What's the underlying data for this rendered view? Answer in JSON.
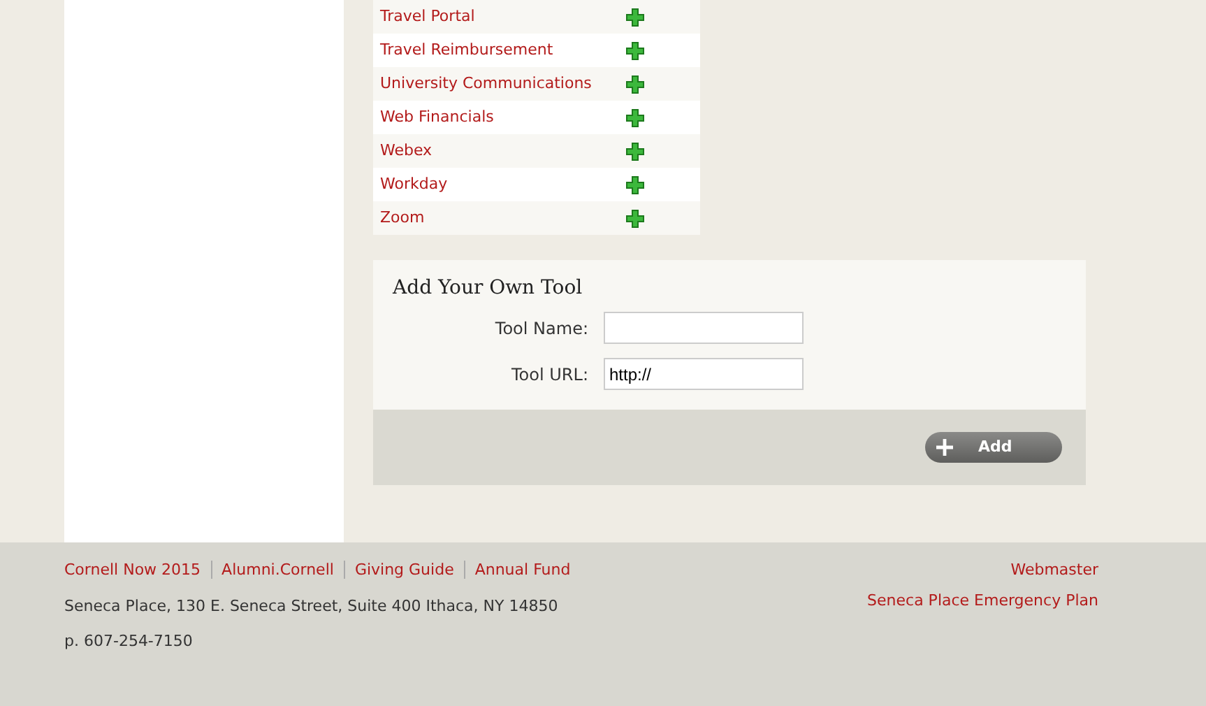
{
  "tools": [
    {
      "label": "Travel Portal"
    },
    {
      "label": "Travel Reimbursement"
    },
    {
      "label": "University Communications"
    },
    {
      "label": "Web Financials"
    },
    {
      "label": "Webex"
    },
    {
      "label": "Workday"
    },
    {
      "label": "Zoom"
    }
  ],
  "add_tool": {
    "title": "Add Your Own Tool",
    "fields": [
      {
        "label": "Tool Name:"
      },
      {
        "label": "Tool URL:",
        "value": "http://"
      }
    ],
    "button": "Add"
  },
  "footer": {
    "links": [
      "Cornell Now 2015",
      "Alumni.Cornell",
      "Giving Guide",
      "Annual Fund"
    ],
    "address": "Seneca Place, 130 E. Seneca Street, Suite 400 Ithaca, NY 14850",
    "phone": "p. 607-254-7150",
    "right_links": [
      "Webmaster",
      "Seneca Place Emergency Plan"
    ]
  }
}
